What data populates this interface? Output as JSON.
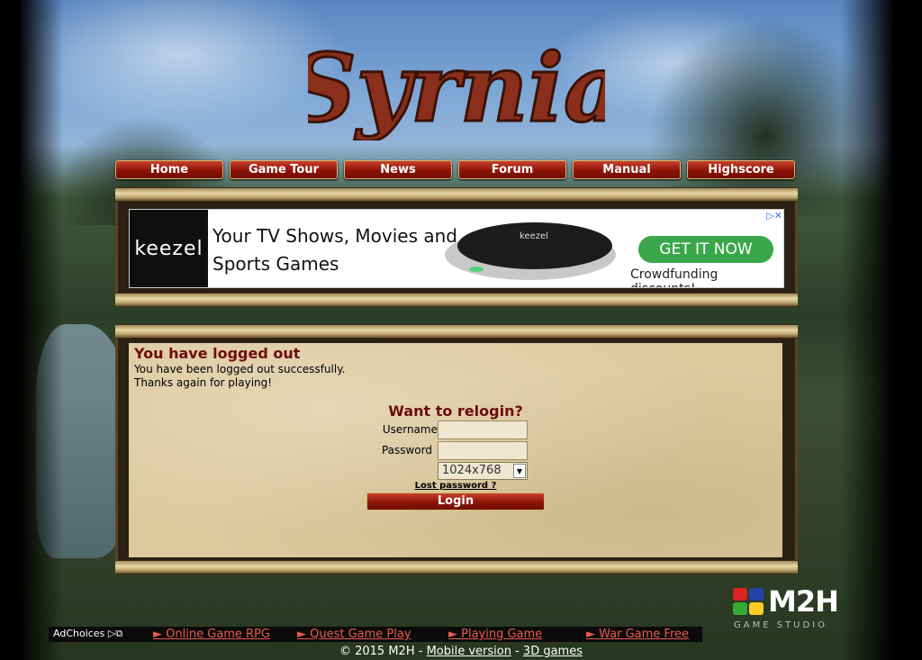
{
  "logo": {
    "text": "Syrnia"
  },
  "nav": {
    "items": [
      "Home",
      "Game Tour",
      "News",
      "Forum",
      "Manual",
      "Highscore"
    ]
  },
  "ad": {
    "brand": "keezel",
    "headline_line1": "Your TV Shows, Movies and",
    "headline_line2": "Sports Games",
    "device_text": "keezel",
    "cta": "GET IT NOW",
    "subtext": "Crowdfunding discounts!",
    "adchoice_icons": "▷✕"
  },
  "logout": {
    "title": "You have logged out",
    "line1": "You have been logged out successfully.",
    "line2": "Thanks again for playing!"
  },
  "relogin": {
    "title": "Want to relogin?",
    "username_label": "Username",
    "password_label": "Password",
    "username_value": "",
    "password_value": "",
    "resolution": "1024x768",
    "lost_password": "Lost password ?",
    "login_button": "Login"
  },
  "studio": {
    "name": "M2H",
    "sub": "GAME STUDIO"
  },
  "adbar": {
    "adchoices": "AdChoices",
    "adchoices_icons": "▷⧉",
    "links": [
      "► Online Game RPG",
      "► Quest Game Play",
      "► Playing Game",
      "► War Game Free"
    ]
  },
  "footer": {
    "copyright": "© 2015 M2H - ",
    "mobile": "Mobile version",
    "sep": " - ",
    "games3d": "3D games"
  },
  "colors": {
    "accent_red": "#8e1308",
    "title_red": "#6e0c0c",
    "panel": "#dcc99e",
    "cta_green": "#3aa84a"
  }
}
